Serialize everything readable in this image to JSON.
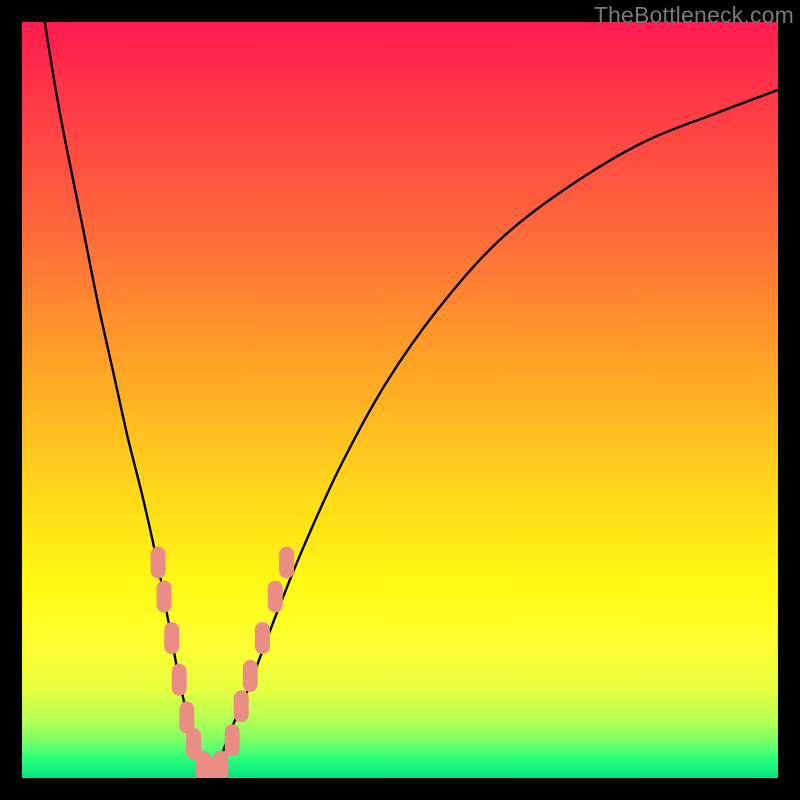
{
  "watermark": "TheBottleneck.com",
  "chart_data": {
    "type": "line",
    "title": "",
    "xlabel": "",
    "ylabel": "",
    "xlim": [
      0,
      100
    ],
    "ylim": [
      0,
      100
    ],
    "series": [
      {
        "name": "bottleneck-curve",
        "x": [
          3,
          5,
          8,
          10,
          12,
          14,
          16,
          18,
          19.5,
          21,
          22.5,
          24,
          25,
          26,
          27.5,
          30,
          33,
          37,
          42,
          48,
          55,
          63,
          72,
          82,
          92,
          100
        ],
        "y": [
          100,
          88,
          73,
          63,
          54,
          45,
          37,
          28,
          20,
          12,
          6,
          2,
          0.5,
          2,
          6,
          12,
          20,
          30,
          41,
          52,
          62,
          71,
          78,
          84,
          88,
          91
        ]
      }
    ],
    "markers": {
      "name": "highlighted-points",
      "color": "#ea8d85",
      "points": [
        {
          "x": 18.0,
          "y": 28.5
        },
        {
          "x": 18.8,
          "y": 24.0
        },
        {
          "x": 19.8,
          "y": 18.5
        },
        {
          "x": 20.8,
          "y": 13.0
        },
        {
          "x": 21.8,
          "y": 8.0
        },
        {
          "x": 22.7,
          "y": 4.5
        },
        {
          "x": 24.0,
          "y": 1.5
        },
        {
          "x": 25.0,
          "y": 0.6
        },
        {
          "x": 26.3,
          "y": 1.5
        },
        {
          "x": 27.8,
          "y": 5.0
        },
        {
          "x": 29.0,
          "y": 9.5
        },
        {
          "x": 30.2,
          "y": 13.5
        },
        {
          "x": 31.8,
          "y": 18.5
        },
        {
          "x": 33.5,
          "y": 24.0
        },
        {
          "x": 35.0,
          "y": 28.5
        }
      ]
    },
    "background_gradient": {
      "top": "#ff1a4f",
      "mid": "#fff814",
      "bottom": "#00e582"
    }
  }
}
